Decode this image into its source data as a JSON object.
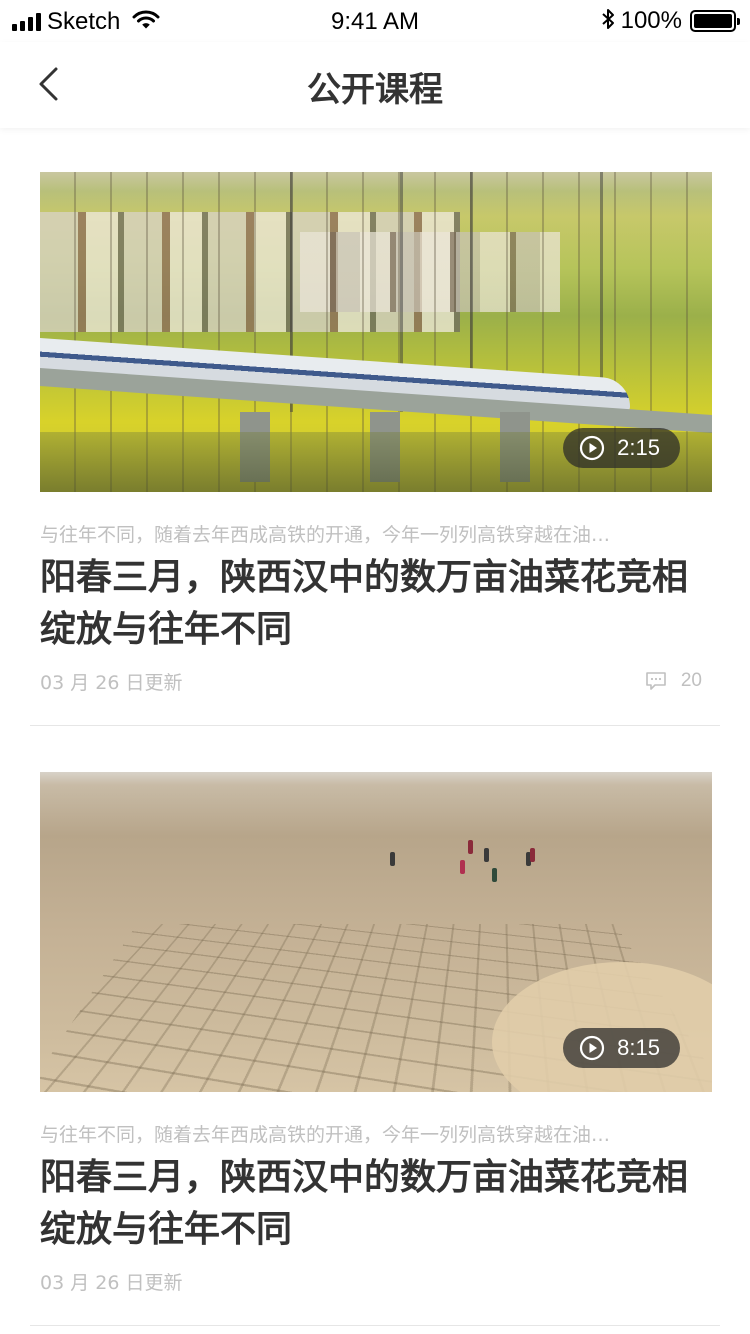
{
  "status_bar": {
    "carrier": "Sketch",
    "time": "9:41 AM",
    "battery": "100%"
  },
  "nav": {
    "title": "公开课程"
  },
  "courses": [
    {
      "duration": "2:15",
      "summary": "与往年不同，随着去年西成高铁的开通，今年一列列高铁穿越在油…",
      "title": "阳春三月，陕西汉中的数万亩油菜花竞相绽放与往年不同",
      "updated": "03 月 26 日更新",
      "comments": "20"
    },
    {
      "duration": "8:15",
      "summary": "与往年不同，随着去年西成高铁的开通，今年一列列高铁穿越在油…",
      "title": "阳春三月，陕西汉中的数万亩油菜花竞相绽放与往年不同",
      "updated": "03 月 26 日更新"
    }
  ]
}
